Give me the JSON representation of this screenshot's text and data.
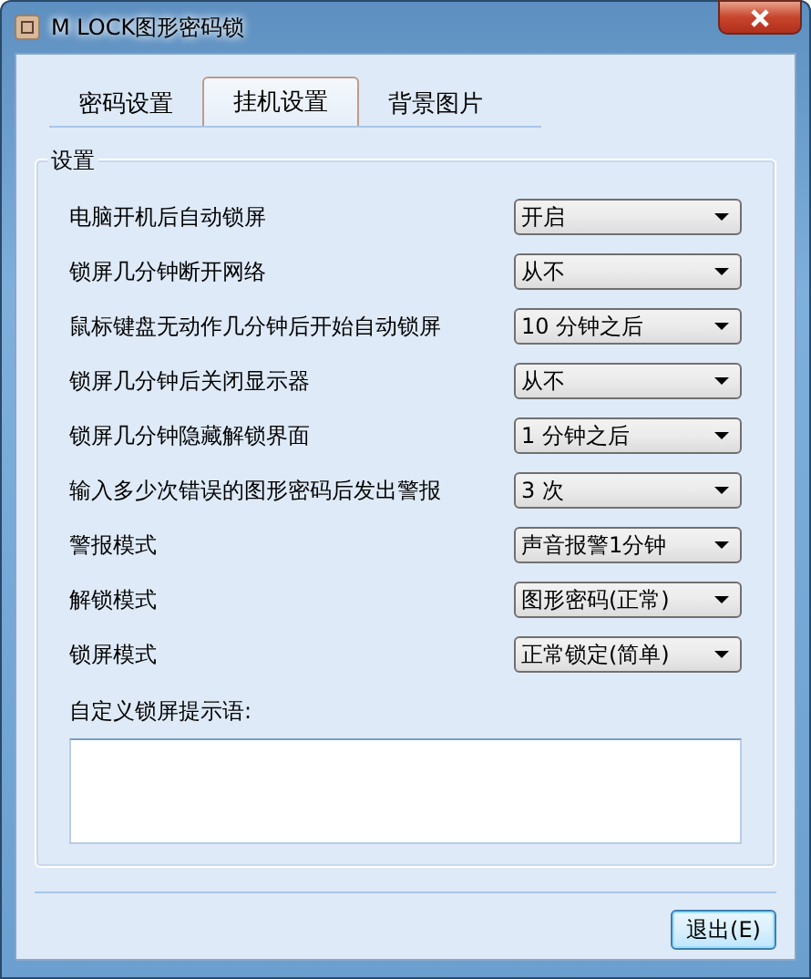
{
  "window": {
    "title": "M LOCK图形密码锁"
  },
  "tabs": [
    {
      "label": "密码设置",
      "selected": false
    },
    {
      "label": "挂机设置",
      "selected": true
    },
    {
      "label": "背景图片",
      "selected": false
    }
  ],
  "group": {
    "title": "设置"
  },
  "settings": [
    {
      "label": "电脑开机后自动锁屏",
      "value": "开启"
    },
    {
      "label": "锁屏几分钟断开网络",
      "value": "从不"
    },
    {
      "label": "鼠标键盘无动作几分钟后开始自动锁屏",
      "value": "10 分钟之后"
    },
    {
      "label": "锁屏几分钟后关闭显示器",
      "value": "从不"
    },
    {
      "label": "锁屏几分钟隐藏解锁界面",
      "value": "1 分钟之后"
    },
    {
      "label": "输入多少次错误的图形密码后发出警报",
      "value": "3 次"
    },
    {
      "label": "警报模式",
      "value": "声音报警1分钟"
    },
    {
      "label": "解锁模式",
      "value": "图形密码(正常)"
    },
    {
      "label": "锁屏模式",
      "value": "正常锁定(简单)"
    }
  ],
  "prompt": {
    "label": "自定义锁屏提示语:"
  },
  "buttons": [
    {
      "label": "退出(E)"
    }
  ]
}
